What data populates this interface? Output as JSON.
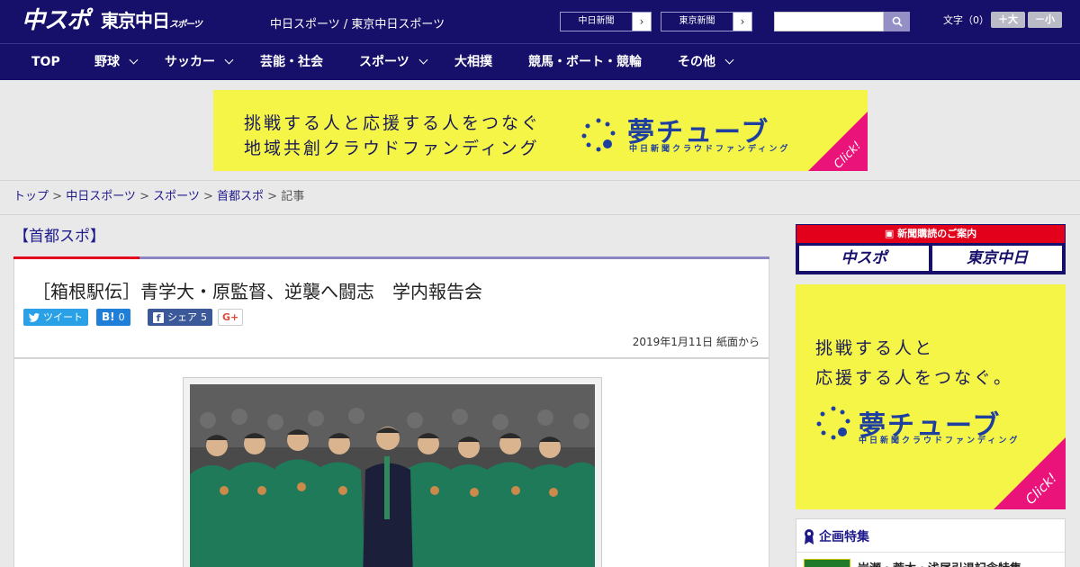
{
  "header": {
    "logo_text": "中スポ",
    "logo2_text": "東京中日",
    "logo2_sub": "スポーツ",
    "site_names": "中日スポーツ / 東京中日スポーツ",
    "paper_buttons": [
      {
        "label": "中日新聞"
      },
      {
        "label": "東京新聞"
      }
    ],
    "search_placeholder": "",
    "font_size_label": "文字（0）",
    "font_larger": "＋大",
    "font_smaller": "－小"
  },
  "nav": {
    "items": [
      {
        "label": "TOP",
        "has_dropdown": false
      },
      {
        "label": "野球",
        "has_dropdown": true
      },
      {
        "label": "サッカー",
        "has_dropdown": true
      },
      {
        "label": "芸能・社会",
        "has_dropdown": false
      },
      {
        "label": "スポーツ",
        "has_dropdown": true
      },
      {
        "label": "大相撲",
        "has_dropdown": false
      },
      {
        "label": "競馬・ボート・競輪",
        "has_dropdown": false
      },
      {
        "label": "その他",
        "has_dropdown": true
      }
    ]
  },
  "banner": {
    "line1": "挑戦する人と応援する人をつなぐ",
    "line2": "地域共創クラウドファンディング",
    "brand": "夢チューブ",
    "brand_sub": "中日新聞クラウドファンディング",
    "click": "Click!"
  },
  "breadcrumb": {
    "items": [
      "トップ",
      "中日スポーツ",
      "スポーツ",
      "首都スポ"
    ],
    "current": "記事"
  },
  "article": {
    "section": "【首都スポ】",
    "title": "［箱根駅伝］青学大・原監督、逆襲へ闘志　学内報告会",
    "share": {
      "tweet": "ツイート",
      "hatena_count": "0",
      "facebook": "シェア",
      "facebook_count": "5",
      "gplus": "G+"
    },
    "date": "2019年1月11日 紙面から"
  },
  "sidebar": {
    "subscription_head": "新聞購読のご案内",
    "subscription_logos": [
      "中スポ",
      "東京中日"
    ],
    "ad": {
      "line1": "挑戦する人と",
      "line2": "応援する人をつなぐ。",
      "brand": "夢チューブ",
      "brand_sub": "中日新聞クラウドファンディング",
      "click": "Click!"
    },
    "feature_head": "企画特集",
    "feature_item": "岩瀬・荒木・浅尾引退記念特集"
  },
  "colors": {
    "header_bg": "#17106a",
    "accent_red": "#e2001a",
    "banner_yellow": "#f4f547",
    "banner_pink": "#e9137a",
    "link": "#1f1a8a"
  }
}
